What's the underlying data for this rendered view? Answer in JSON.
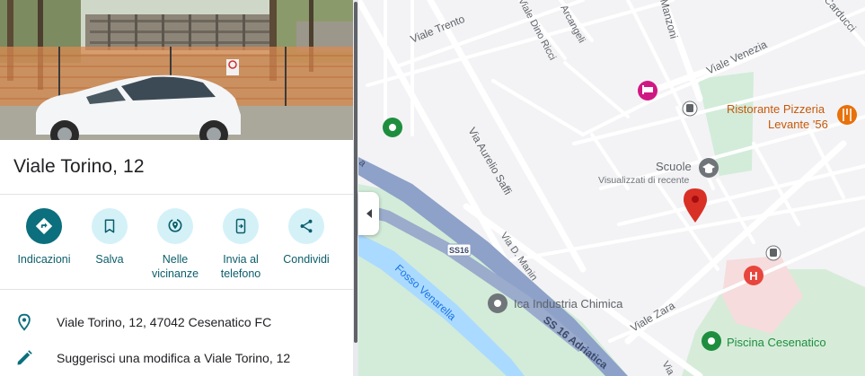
{
  "place": {
    "title": "Viale Torino, 12"
  },
  "actions": [
    {
      "label": "Indicazioni",
      "icon": "directions-icon"
    },
    {
      "label": "Salva",
      "icon": "bookmark-icon"
    },
    {
      "label": "Nelle vicinanze",
      "icon": "nearby-icon"
    },
    {
      "label": "Invia al telefono",
      "icon": "send-to-phone-icon"
    },
    {
      "label": "Condividi",
      "icon": "share-icon"
    }
  ],
  "info": {
    "address": "Viale Torino, 12, 47042 Cesenatico FC",
    "suggest_edit": "Suggerisci una modifica a Viale Torino, 12"
  },
  "map": {
    "streets": {
      "viale_trento": "Viale Trento",
      "dino_ricci": "Viale Dino Ricci",
      "arcangeli": "Arcangeli",
      "manzoni": "Manzoni",
      "carducci": "Carducci",
      "viale_venezia": "Viale Venezia",
      "aurelio_saffi": "Via Aurelio Saffi",
      "d_manin": "Via D. Manin",
      "ss16_badge": "SS16",
      "ss16_road": "SS 16 Adriatica",
      "fosso": "Fosso Venarella",
      "viale_zara": "Viale Zara",
      "via_partial": "Via"
    },
    "pois": {
      "ristorante_line1": "Ristorante Pizzeria",
      "ristorante_line2": "Levante '56",
      "scuole": "Scuole",
      "scuole_sub": "Visualizzati di recente",
      "ica": "Ica Industria Chimica",
      "piscina": "Piscina Cesenatico"
    },
    "colors": {
      "background": "#f3f3f5",
      "park": "#cfead7",
      "water": "#aadaff",
      "highway": "#8ea1c8",
      "pin": "#d93025",
      "restaurant": "#e8710a",
      "poi_green": "#1e8e3e",
      "poi_gray": "#70757a",
      "hotel": "#d01884",
      "hospital": "#e8453c"
    }
  }
}
